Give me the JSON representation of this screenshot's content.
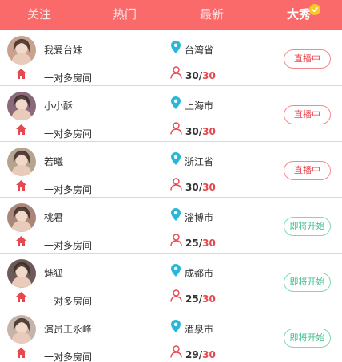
{
  "tabs": [
    {
      "label": "关注"
    },
    {
      "label": "热门"
    },
    {
      "label": "最新"
    },
    {
      "label": "大秀"
    }
  ],
  "rows": [
    {
      "name": "我爱台妹",
      "room": "一对多房间",
      "location": "台湾省",
      "current": "30",
      "sep": "/",
      "max": "30",
      "status": "直播中",
      "status_type": "live",
      "avatar_bg": "#c9a28f"
    },
    {
      "name": "小小酥",
      "room": "一对多房间",
      "location": "上海市",
      "current": "30",
      "sep": "/",
      "max": "30",
      "status": "直播中",
      "status_type": "live",
      "avatar_bg": "#8a6a7a"
    },
    {
      "name": "若曦",
      "room": "一对多房间",
      "location": "浙江省",
      "current": "30",
      "sep": "/",
      "max": "30",
      "status": "直播中",
      "status_type": "live",
      "avatar_bg": "#b7a48f"
    },
    {
      "name": "桃君",
      "room": "一对多房间",
      "location": "淄博市",
      "current": "25",
      "sep": "/",
      "max": "30",
      "status": "即将开始",
      "status_type": "soon",
      "avatar_bg": "#a8877a"
    },
    {
      "name": "魅狐",
      "room": "一对多房间",
      "location": "成都市",
      "current": "25",
      "sep": "/",
      "max": "30",
      "status": "即将开始",
      "status_type": "soon",
      "avatar_bg": "#6e5a58"
    },
    {
      "name": "演员王永峰",
      "room": "一对多房间",
      "location": "酒泉市",
      "current": "29",
      "sep": "/",
      "max": "30",
      "status": "即将开始",
      "status_type": "soon",
      "avatar_bg": "#c6b4a8"
    }
  ],
  "colors": {
    "header": "#fb6a6a",
    "live": "#e8474e",
    "soon": "#3fbf8b",
    "pin": "#27b7d8",
    "home": "#e8474e"
  }
}
